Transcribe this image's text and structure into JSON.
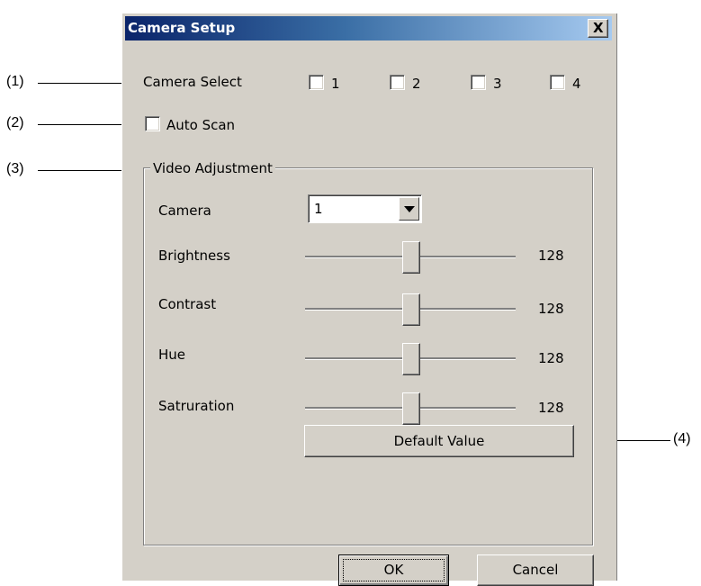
{
  "callouts": [
    "(1)",
    "(2)",
    "(3)",
    "(4)"
  ],
  "dialog": {
    "title": "Camera Setup",
    "close_label": "X"
  },
  "camera_select": {
    "label": "Camera Select",
    "options": [
      {
        "label": "1",
        "checked": false
      },
      {
        "label": "2",
        "checked": false
      },
      {
        "label": "3",
        "checked": false
      },
      {
        "label": "4",
        "checked": false
      }
    ]
  },
  "auto_scan": {
    "label": "Auto Scan",
    "checked": false
  },
  "video_adjustment": {
    "legend": "Video Adjustment",
    "camera_label": "Camera",
    "camera_value": "1",
    "sliders": [
      {
        "label": "Brightness",
        "value": "128"
      },
      {
        "label": "Contrast",
        "value": "128"
      },
      {
        "label": "Hue",
        "value": "128"
      },
      {
        "label": "Satruration",
        "value": "128"
      }
    ],
    "slider_position_fraction": 0.5,
    "default_button": "Default Value"
  },
  "buttons": {
    "ok": "OK",
    "cancel": "Cancel"
  },
  "colors": {
    "title_start": "#0a246a",
    "title_end": "#a6caf0",
    "face": "#d4d0c8"
  }
}
